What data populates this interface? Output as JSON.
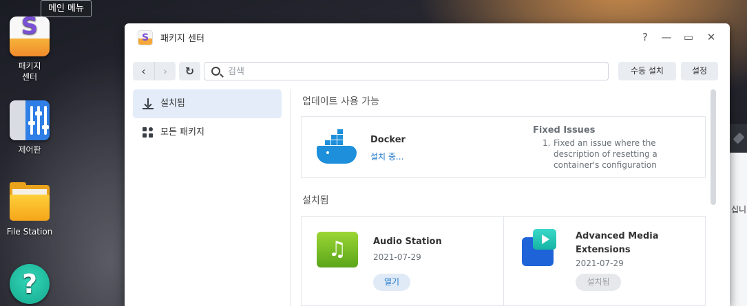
{
  "tooltip": "메인 메뉴",
  "desktop": {
    "icons": [
      {
        "label_1": "패키지",
        "label_2": "센터"
      },
      {
        "label": "제어판"
      },
      {
        "label": "File Station"
      },
      {
        "label": ""
      }
    ]
  },
  "background_window": {
    "text": "십니다"
  },
  "window": {
    "title": "패키지 센터",
    "controls": {
      "help": "?",
      "minimize": "—",
      "maximize": "▭",
      "close": "✕"
    }
  },
  "toolbar": {
    "back": "‹",
    "forward": "›",
    "refresh": "↻",
    "search_placeholder": "검색",
    "manual_install_label": "수동 설치",
    "settings_label": "설정"
  },
  "sidebar": {
    "items": [
      {
        "label": "설치됨",
        "icon": "download-icon",
        "active": true
      },
      {
        "label": "모든 패키지",
        "icon": "grid-icon",
        "active": false
      }
    ]
  },
  "updates": {
    "section_title": "업데이트 사용 가능",
    "items": [
      {
        "name": "Docker",
        "status": "설치 중...",
        "fixed_title": "Fixed Issues",
        "fixed_num": "1.",
        "fixed_text": "Fixed an issue where the description of resetting a container's configuration"
      }
    ]
  },
  "installed": {
    "section_title": "설치됨",
    "items": [
      {
        "name": "Audio Station",
        "date": "2021-07-29",
        "button": "열기",
        "icon": "audio-station-icon"
      },
      {
        "name_1": "Advanced Media",
        "name_2": "Extensions",
        "date": "2021-07-29",
        "button": "설치됨",
        "icon": "advanced-media-extensions-icon"
      }
    ]
  },
  "colors": {
    "accent": "#1a76c9",
    "sidebar_active": "#e3ecf8",
    "docker_blue": "#1d8fdb",
    "audio_green": "#7cc128"
  }
}
